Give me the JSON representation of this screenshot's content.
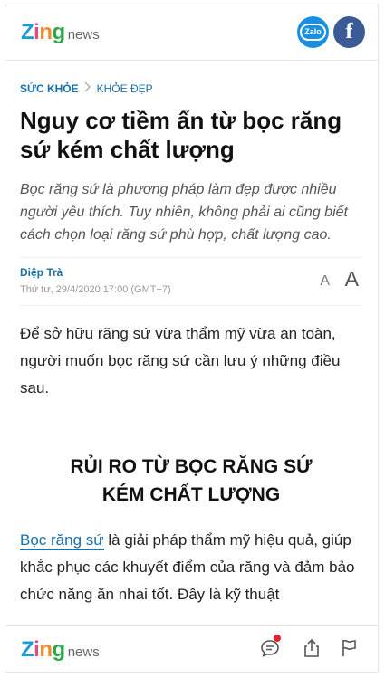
{
  "header": {
    "logo_zing": "Zing",
    "logo_news": "news",
    "zalo_label": "Zalo",
    "facebook_label": "f"
  },
  "breadcrumb": {
    "category": "SỨC KHỎE",
    "subcategory": "KHỎE ĐẸP"
  },
  "article": {
    "title": "Nguy cơ tiềm ẩn từ bọc răng sứ kém chất lượng",
    "sapo": "Bọc răng sứ là phương pháp làm đẹp được nhiều người yêu thích. Tuy nhiên, không phải ai cũng biết cách chọn loại răng sứ phù hợp, chất lượng cao.",
    "author": "Diệp Trà",
    "date": "Thứ tư, 29/4/2020 17:00 (GMT+7)",
    "font_small": "A",
    "font_large": "A",
    "paragraph_1": "Để sở hữu răng sứ vừa thẩm mỹ vừa an toàn, người muốn bọc răng sứ cần lưu ý những điều sau.",
    "heading_line_1": "RỦI RO TỪ BỌC RĂNG SỨ",
    "heading_line_2": "KÉM CHẤT LƯỢNG",
    "paragraph_2_link": "Bọc răng sứ",
    "paragraph_2_rest": " là giải pháp thẩm mỹ hiệu quả, giúp khắc phục các khuyết điểm của răng và đảm bảo chức năng ăn nhai tốt. Đây là kỹ thuật"
  },
  "footer": {
    "logo_zing": "Zing",
    "logo_news": "news",
    "icons": [
      "comment-icon",
      "share-icon",
      "flag-icon"
    ]
  },
  "colors": {
    "accent": "#1b6fa8",
    "zalo": "#1a8fe0",
    "facebook": "#3b5b96",
    "notification": "#e8202a"
  }
}
